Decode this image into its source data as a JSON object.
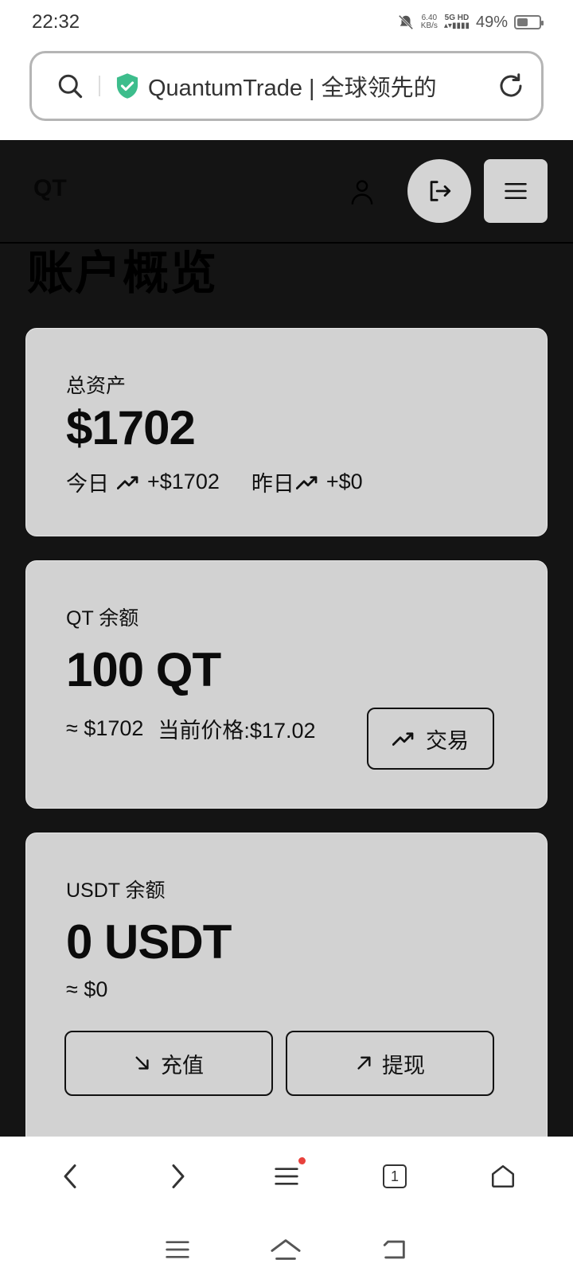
{
  "status": {
    "time": "22:32",
    "net_speed_value": "6.40",
    "net_speed_unit": "KB/s",
    "network": "5G HD",
    "battery": "49%",
    "battery_level": 0.49
  },
  "browser": {
    "url_text": "QuantumTrade | 全球领先的"
  },
  "site": {
    "logo": "QT",
    "page_title": "账户概览"
  },
  "total_card": {
    "label": "总资产",
    "value": "$1702",
    "today_label": "今日",
    "today_change": "+$1702",
    "yesterday_label": "昨日",
    "yesterday_change": "+$0"
  },
  "qt_card": {
    "label": "QT 余额",
    "value": "100 QT",
    "approx": "≈ $1702",
    "price": "当前价格:$17.02",
    "trade_button": "交易"
  },
  "usdt_card": {
    "label": "USDT 余额",
    "value": "0 USDT",
    "approx": "≈ $0",
    "deposit_button": "充值",
    "withdraw_button": "提现"
  },
  "tabs_count": "1",
  "colors": {
    "site_bg": "#141414",
    "card_bg": "#d2d2d2",
    "secure_green": "#3dbd8c",
    "notification_dot": "#e8413c"
  }
}
